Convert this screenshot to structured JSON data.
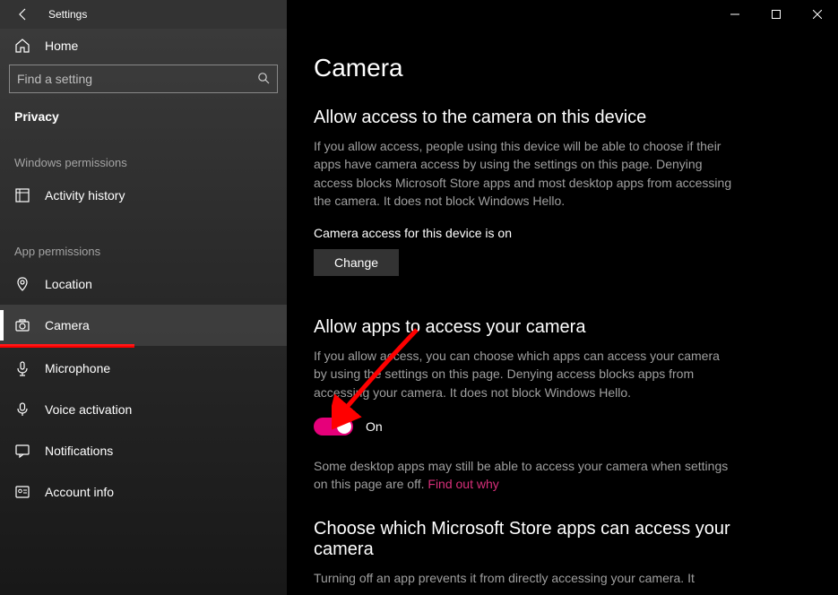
{
  "window": {
    "title": "Settings"
  },
  "sidebar": {
    "home": "Home",
    "searchPlaceholder": "Find a setting",
    "breadcrumb": "Privacy",
    "group1": "Windows permissions",
    "group2": "App permissions",
    "items1": [
      {
        "label": "Activity history"
      }
    ],
    "items2": [
      {
        "label": "Location"
      },
      {
        "label": "Camera"
      },
      {
        "label": "Microphone"
      },
      {
        "label": "Voice activation"
      },
      {
        "label": "Notifications"
      },
      {
        "label": "Account info"
      }
    ]
  },
  "content": {
    "pageTitle": "Camera",
    "sec1": {
      "heading": "Allow access to the camera on this device",
      "body": "If you allow access, people using this device will be able to choose if their apps have camera access by using the settings on this page. Denying access blocks Microsoft Store apps and most desktop apps from accessing the camera. It does not block Windows Hello.",
      "status": "Camera access for this device is on",
      "button": "Change"
    },
    "sec2": {
      "heading": "Allow apps to access your camera",
      "body": "If you allow access, you can choose which apps can access your camera by using the settings on this page. Denying access blocks apps from accessing your camera. It does not block Windows Hello.",
      "toggleState": "On",
      "note1": "Some desktop apps may still be able to access your camera when settings on this page are off. ",
      "link": "Find out why"
    },
    "sec3": {
      "heading": "Choose which Microsoft Store apps can access your camera",
      "body": "Turning off an app prevents it from directly accessing your camera. It"
    }
  }
}
